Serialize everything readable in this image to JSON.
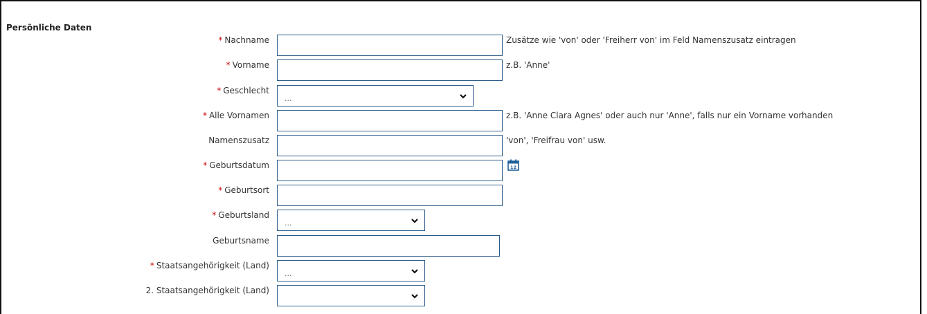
{
  "section": {
    "title": "Persönliche Daten"
  },
  "required_marker": "*",
  "fields": {
    "nachname": {
      "label": "Nachname",
      "required": true,
      "value": "",
      "hint": "Zusätze wie 'von' oder 'Freiherr von' im Feld Namenszusatz eintragen"
    },
    "vorname": {
      "label": "Vorname",
      "required": true,
      "value": "",
      "hint": "z.B. 'Anne'"
    },
    "geschlecht": {
      "label": "Geschlecht",
      "required": true,
      "selected": "..."
    },
    "alle_vornamen": {
      "label": "Alle Vornamen",
      "required": true,
      "value": "",
      "hint": "z.B. 'Anne Clara Agnes' oder auch nur 'Anne', falls nur ein Vorname vorhanden"
    },
    "namenszusatz": {
      "label": "Namenszusatz",
      "required": false,
      "value": "",
      "hint": "'von', 'Freifrau von' usw."
    },
    "geburtsdatum": {
      "label": "Geburtsdatum",
      "required": true,
      "value": "",
      "icon": "calendar-icon",
      "icon_day": "12"
    },
    "geburtsort": {
      "label": "Geburtsort",
      "required": true,
      "value": ""
    },
    "geburtsland": {
      "label": "Geburtsland",
      "required": true,
      "selected": "..."
    },
    "geburtsname": {
      "label": "Geburtsname",
      "required": false,
      "value": ""
    },
    "staatsangehoerigkeit": {
      "label": "Staatsangehörigkeit (Land)",
      "required": true,
      "selected": "..."
    },
    "staatsangehoerigkeit2": {
      "label": "2. Staatsangehörigkeit (Land)",
      "required": false,
      "selected": ""
    }
  },
  "colors": {
    "required": "#cc0000",
    "border": "#2b5b8a",
    "icon": "#1f5f99"
  }
}
